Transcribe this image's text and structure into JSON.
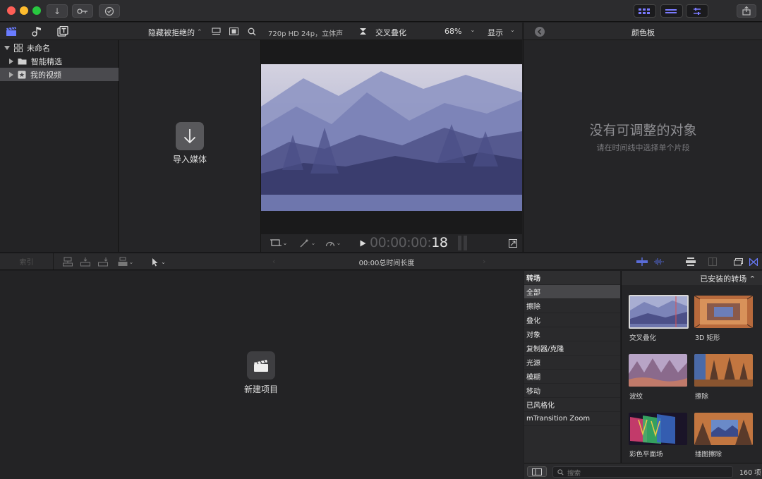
{
  "library": {
    "filter_label": "隐藏被拒绝的",
    "tree": [
      {
        "label": "未命名",
        "expanded": true
      },
      {
        "label": "智能精选",
        "expanded": false
      },
      {
        "label": "我的视频",
        "expanded": false,
        "selected": true
      }
    ],
    "import_label": "导入媒体"
  },
  "viewer": {
    "format_label": "720p HD 24p，立体声",
    "clip_name": "交叉叠化",
    "zoom": "68%",
    "view_label": "显示",
    "timecode_dim": "00:00:00:",
    "timecode_frames": "18"
  },
  "inspector": {
    "title": "颜色板",
    "empty_title": "没有可调整的对象",
    "empty_hint": "请在时间线中选择单个片段"
  },
  "timeline": {
    "index_label": "索引",
    "duration_label": "00:00总时间长度",
    "new_project_label": "新建项目"
  },
  "transitions": {
    "header": "转场",
    "installed_label": "已安装的转场",
    "categories": [
      "全部",
      "擦除",
      "叠化",
      "对象",
      "复制器/克隆",
      "光源",
      "模糊",
      "移动",
      "已风格化",
      "mTransition Zoom"
    ],
    "items": [
      {
        "label": "交叉叠化"
      },
      {
        "label": "3D 矩形"
      },
      {
        "label": "波纹"
      },
      {
        "label": "擦除"
      },
      {
        "label": "彩色平面场"
      },
      {
        "label": "插图擦除"
      }
    ],
    "search_placeholder": "搜索",
    "count_label": "160 项"
  }
}
